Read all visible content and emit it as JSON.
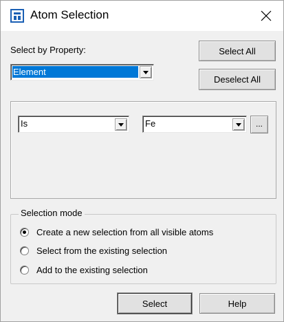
{
  "window": {
    "title": "Atom Selection",
    "close_glyph": "×"
  },
  "property": {
    "label": "Select by Property:",
    "selected": "Element"
  },
  "buttons": {
    "select_all": "Select All",
    "deselect_all": "Deselect All",
    "more": "...",
    "select": "Select",
    "help": "Help"
  },
  "filter": {
    "operator": "Is",
    "value": "Fe"
  },
  "selection_mode": {
    "title": "Selection mode",
    "options": [
      {
        "label": "Create a new selection from all visible atoms",
        "checked": true
      },
      {
        "label": "Select from the existing selection",
        "checked": false
      },
      {
        "label": "Add to the existing selection",
        "checked": false
      }
    ]
  },
  "colors": {
    "accent": "#0078d7",
    "icon": "#1a5fb4"
  }
}
